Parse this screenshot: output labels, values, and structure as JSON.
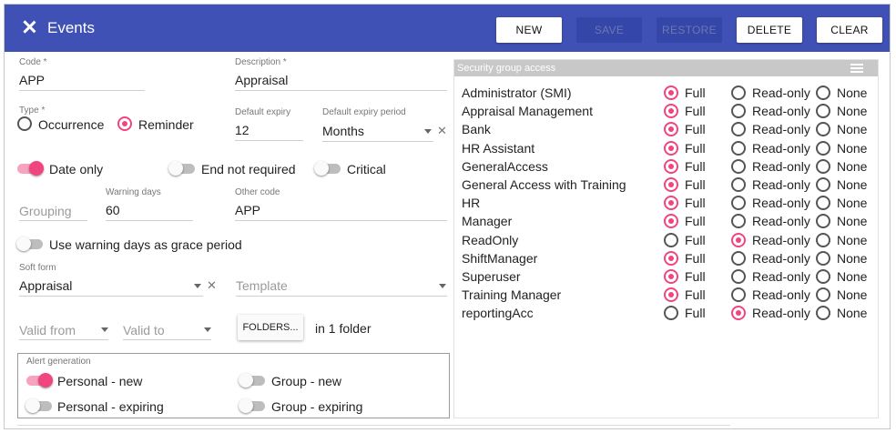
{
  "header": {
    "title": "Events",
    "buttons": {
      "new": "NEW",
      "save": "SAVE",
      "restore": "RESTORE",
      "delete": "DELETE",
      "clear": "CLEAR"
    }
  },
  "form": {
    "code": {
      "label": "Code *",
      "value": "APP"
    },
    "description": {
      "label": "Description *",
      "value": "Appraisal"
    },
    "type": {
      "label": "Type *",
      "options": [
        "Occurrence",
        "Reminder"
      ],
      "selected": "Reminder"
    },
    "default_expiry": {
      "label": "Default expiry",
      "value": "12"
    },
    "default_expiry_period": {
      "label": "Default expiry period",
      "value": "Months"
    },
    "toggles": [
      {
        "label": "Date only",
        "on": true
      },
      {
        "label": "End not required",
        "on": false
      },
      {
        "label": "Critical",
        "on": false
      }
    ],
    "grouping": {
      "placeholder": "Grouping"
    },
    "warning_days": {
      "label": "Warning days",
      "value": "60"
    },
    "other_code": {
      "label": "Other code",
      "value": "APP"
    },
    "grace_toggle": {
      "label": "Use warning days as grace period",
      "on": false
    },
    "soft_form": {
      "label": "Soft form",
      "value": "Appraisal"
    },
    "template": {
      "placeholder": "Template"
    },
    "valid_from": {
      "placeholder": "Valid from"
    },
    "valid_to": {
      "placeholder": "Valid to"
    },
    "folders_button": "FOLDERS...",
    "folder_count_text": "in 1 folder"
  },
  "alert_generation": {
    "title": "Alert generation",
    "items": [
      {
        "label": "Personal - new",
        "on": true
      },
      {
        "label": "Group - new",
        "on": false
      },
      {
        "label": "Personal - expiring",
        "on": false
      },
      {
        "label": "Group - expiring",
        "on": false
      }
    ]
  },
  "security": {
    "title": "Security group access",
    "access_labels": [
      "Full",
      "Read-only",
      "None"
    ],
    "groups": [
      {
        "name": "Administrator (SMI)",
        "access": "Full"
      },
      {
        "name": "Appraisal Management",
        "access": "Full"
      },
      {
        "name": "Bank",
        "access": "Full"
      },
      {
        "name": "HR Assistant",
        "access": "Full"
      },
      {
        "name": "GeneralAccess",
        "access": "Full"
      },
      {
        "name": "General Access with Training",
        "access": "Full"
      },
      {
        "name": "HR",
        "access": "Full"
      },
      {
        "name": "Manager",
        "access": "Full"
      },
      {
        "name": "ReadOnly",
        "access": "Read-only"
      },
      {
        "name": "ShiftManager",
        "access": "Full"
      },
      {
        "name": "Superuser",
        "access": "Full"
      },
      {
        "name": "Training Manager",
        "access": "Full"
      },
      {
        "name": "reportingAcc",
        "access": "Read-only"
      }
    ]
  },
  "colors": {
    "header": "#3f51b5",
    "accent": "#f0457f"
  }
}
